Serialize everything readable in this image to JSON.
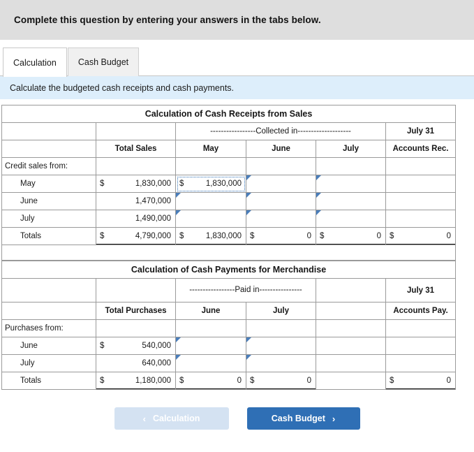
{
  "instruction": {
    "main": "Complete this question by entering your answers in the tabs below.",
    "sub": "Calculate the budgeted cash receipts and cash payments."
  },
  "tabs": [
    {
      "label": "Calculation",
      "active": true
    },
    {
      "label": "Cash Budget",
      "active": false
    }
  ],
  "receipts_table": {
    "title": "Calculation of Cash Receipts from Sales",
    "group_header": "-----------------Collected in--------------------",
    "group_header_right": "July 31",
    "columns": [
      "",
      "Total Sales",
      "May",
      "June",
      "July",
      "Accounts Rec."
    ],
    "section_label": "Credit sales from:",
    "rows": [
      {
        "label": "May",
        "total_sales_sym": "$",
        "total_sales": "1,830,000",
        "may_sym": "$",
        "may": "1,830,000",
        "june": "",
        "july": "",
        "accounts_rec": ""
      },
      {
        "label": "June",
        "total_sales_sym": "",
        "total_sales": "1,470,000",
        "may_sym": "",
        "may": "",
        "june": "",
        "july": "",
        "accounts_rec": ""
      },
      {
        "label": "July",
        "total_sales_sym": "",
        "total_sales": "1,490,000",
        "may_sym": "",
        "may": "",
        "june": "",
        "july": "",
        "accounts_rec": ""
      }
    ],
    "totals": {
      "label": "Totals",
      "total_sales_sym": "$",
      "total_sales": "4,790,000",
      "may_sym": "$",
      "may": "1,830,000",
      "june_sym": "$",
      "june": "0",
      "july_sym": "$",
      "july": "0",
      "accounts_rec_sym": "$",
      "accounts_rec": "0"
    }
  },
  "payments_table": {
    "title": "Calculation of Cash Payments for Merchandise",
    "group_header": "-----------------Paid in----------------",
    "group_header_right": "July 31",
    "columns": [
      "",
      "Total Purchases",
      "June",
      "July",
      "",
      "Accounts Pay."
    ],
    "section_label": "Purchases from:",
    "rows": [
      {
        "label": "June",
        "total_purch_sym": "$",
        "total_purch": "540,000",
        "june": "",
        "july": "",
        "accounts_pay": ""
      },
      {
        "label": "July",
        "total_purch_sym": "",
        "total_purch": "640,000",
        "june": "",
        "july": "",
        "accounts_pay": ""
      }
    ],
    "totals": {
      "label": "Totals",
      "total_purch_sym": "$",
      "total_purch": "1,180,000",
      "june_sym": "$",
      "june": "0",
      "july_sym": "$",
      "july": "0",
      "accounts_pay_sym": "$",
      "accounts_pay": "0"
    }
  },
  "nav": {
    "prev_label": "Calculation",
    "prev_chevron": "‹",
    "next_label": "Cash Budget",
    "next_chevron": "›"
  },
  "colors": {
    "title_blue": "#74ACE4",
    "header_blue_gray": "#b6c1d8",
    "instruction_gray": "#dedede",
    "sub_instruction_blue": "#ddeefb",
    "primary_button": "#2f6fb5",
    "disabled_button": "#d4e2f2",
    "cell_border_blue": "#4a7ebb"
  }
}
